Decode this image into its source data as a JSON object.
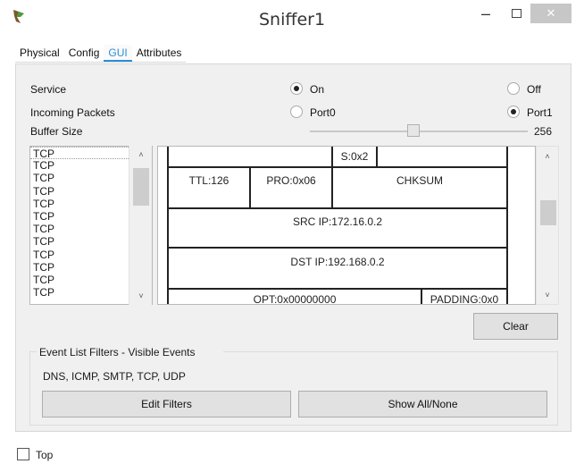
{
  "window": {
    "title": "Sniffer1",
    "min_glyph": "–",
    "close_glyph": "✕"
  },
  "tabs": [
    {
      "label": "Physical"
    },
    {
      "label": "Config"
    },
    {
      "label": "GUI"
    },
    {
      "label": "Attributes"
    }
  ],
  "active_tab": "GUI",
  "service": {
    "label": "Service",
    "on_label": "On",
    "off_label": "Off",
    "selected": "On"
  },
  "incoming": {
    "label": "Incoming Packets",
    "port0_label": "Port0",
    "port1_label": "Port1",
    "selected": "Port1"
  },
  "buffer": {
    "label": "Buffer Size",
    "value": "256"
  },
  "event_list": {
    "items": [
      "TCP",
      "TCP",
      "TCP",
      "TCP",
      "TCP",
      "TCP",
      "TCP",
      "TCP",
      "TCP",
      "TCP",
      "TCP",
      "TCP"
    ],
    "scroll_up": "˄",
    "scroll_down": "˅"
  },
  "packet": {
    "flags": "S:0x2",
    "ttl": "TTL:126",
    "pro": "PRO:0x06",
    "chksum": "CHKSUM",
    "src_ip": "SRC IP:172.16.0.2",
    "dst_ip": "DST IP:192.168.0.2",
    "opt": "OPT:0x00000000",
    "padding": "PADDING:0x0"
  },
  "clear_label": "Clear",
  "filters": {
    "title": "Event List Filters - Visible Events",
    "text": "DNS, ICMP, SMTP, TCP, UDP",
    "edit_label": "Edit Filters",
    "show_all_label": "Show All/None"
  },
  "bottom": {
    "top_label": "Top",
    "top_checked": false
  },
  "colors": {
    "accent": "#2b8fd6",
    "panel": "#f0f0f0",
    "button": "#e1e1e1"
  }
}
